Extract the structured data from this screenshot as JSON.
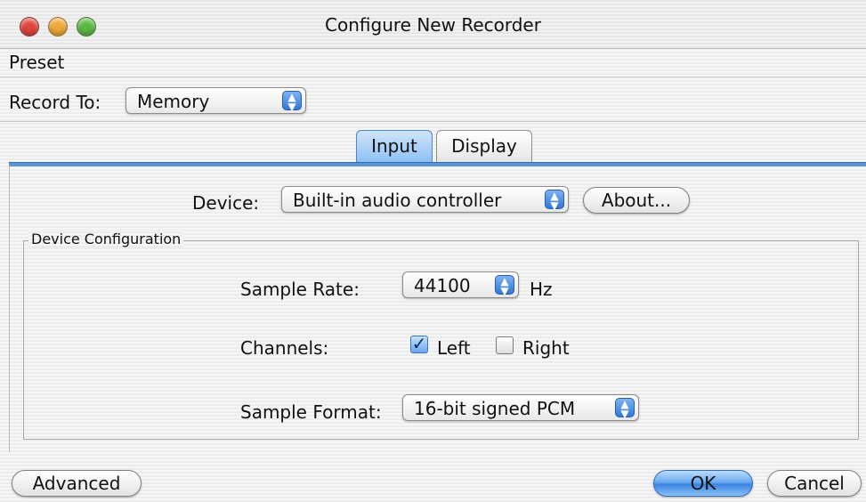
{
  "window": {
    "title": "Configure New Recorder"
  },
  "menu": {
    "preset_label": "Preset"
  },
  "record_to": {
    "label": "Record To:",
    "value": "Memory"
  },
  "tabs": [
    {
      "label": "Input",
      "active": true
    },
    {
      "label": "Display",
      "active": false
    }
  ],
  "device": {
    "label": "Device:",
    "value": "Built-in audio controller",
    "about_label": "About..."
  },
  "device_configuration": {
    "title": "Device Configuration",
    "sample_rate": {
      "label": "Sample Rate:",
      "value": "44100",
      "unit": "Hz"
    },
    "channels": {
      "label": "Channels:",
      "left_label": "Left",
      "left_checked": true,
      "right_label": "Right",
      "right_checked": false
    },
    "sample_format": {
      "label": "Sample Format:",
      "value": "16-bit signed PCM"
    }
  },
  "footer": {
    "advanced_label": "Advanced",
    "ok_label": "OK",
    "cancel_label": "Cancel"
  },
  "colors": {
    "accent": "#3b84e0",
    "close": "#e0443c",
    "minimize": "#eea737",
    "zoom": "#5cb844"
  }
}
